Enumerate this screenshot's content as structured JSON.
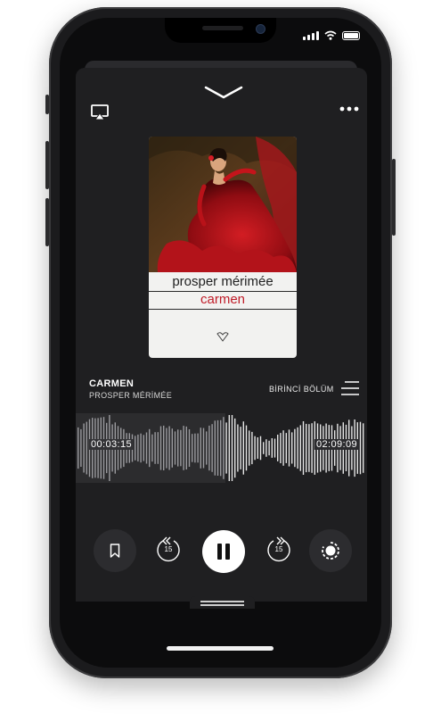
{
  "colors": {
    "background": "#1f1f21",
    "accent": "#ffffff",
    "cover_title": "#c01c28"
  },
  "header": {
    "icons": [
      "airplay-icon",
      "chevron-down-icon",
      "more-icon"
    ]
  },
  "book": {
    "cover_author": "prosper mérimée",
    "cover_title": "carmen",
    "title": "CARMEN",
    "author": "PROSPER MÉRİMÉE"
  },
  "chapter": {
    "label": "BİRİNCİ BÖLÜM",
    "icon": "chapter-list-icon"
  },
  "progress": {
    "current": "00:03:15",
    "total": "02:09:09",
    "fraction": 0.025
  },
  "controls": {
    "rewind_seconds": "15",
    "forward_seconds": "15",
    "icons": [
      "bookmark-icon",
      "rewind-icon",
      "pause-icon",
      "forward-icon",
      "speed-icon"
    ]
  }
}
